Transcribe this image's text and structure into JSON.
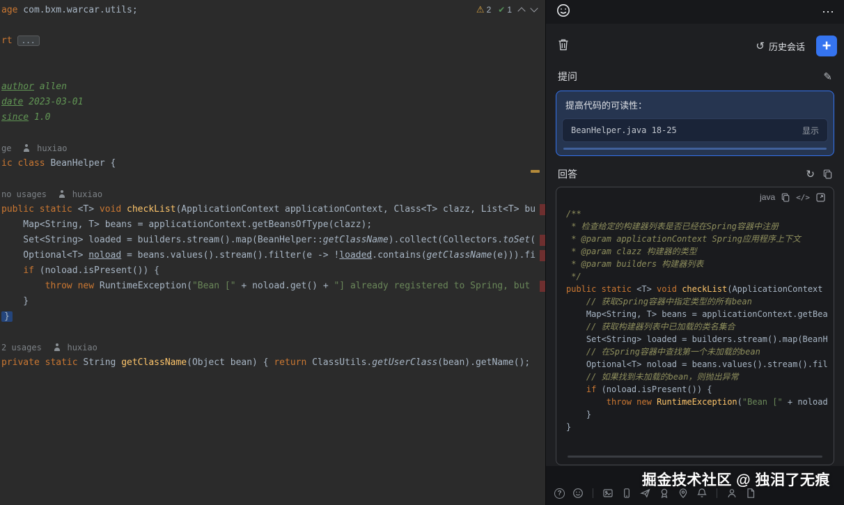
{
  "icons": {
    "warning": "⚠",
    "ok": "✔",
    "more": "⋯",
    "history": "↺",
    "plus": "+",
    "pencil": "✎",
    "refresh": "↻",
    "code": "</>",
    "help": "?"
  },
  "editor": {
    "inspections": {
      "warning_count": "2",
      "ok_count": "1"
    },
    "lines": [
      {
        "segs": [
          [
            "k",
            "age"
          ],
          [
            "t",
            " com.bxm.warcar.utils;"
          ]
        ]
      },
      {
        "segs": []
      },
      {
        "segs": [
          [
            "k",
            "rt"
          ],
          [
            "f",
            "..."
          ]
        ]
      },
      {
        "segs": []
      },
      {
        "segs": []
      },
      {
        "segs": [
          [
            "ct",
            "author"
          ],
          [
            "c",
            " allen"
          ]
        ]
      },
      {
        "segs": [
          [
            "ct",
            "date"
          ],
          [
            "c",
            " 2023-03-01"
          ]
        ]
      },
      {
        "segs": [
          [
            "ct",
            "since"
          ],
          [
            "c",
            " 1.0"
          ]
        ]
      },
      {
        "segs": []
      },
      {
        "segs": [
          [
            "g",
            "ge  "
          ],
          [
            "icon",
            "author-avatar-icon"
          ],
          [
            "g",
            " huxiao"
          ]
        ]
      },
      {
        "segs": [
          [
            "k",
            "ic class"
          ],
          [
            "t",
            " BeanHelper {"
          ]
        ]
      },
      {
        "segs": []
      },
      {
        "segs": [
          [
            "g",
            "no usages  "
          ],
          [
            "icon",
            "author-avatar-icon"
          ],
          [
            "g",
            " huxiao"
          ]
        ]
      },
      {
        "segs": [
          [
            "k",
            "public static"
          ],
          [
            "t",
            " <T> "
          ],
          [
            "k",
            "void"
          ],
          [
            "t",
            " "
          ],
          [
            "m",
            "checkList"
          ],
          [
            "t",
            "(ApplicationContext applicationContext, Class<T> clazz, List<T> bu"
          ]
        ],
        "edge": true
      },
      {
        "segs": [
          [
            "t",
            "    Map<String, T> beans = applicationContext.getBeansOfType(clazz);"
          ]
        ]
      },
      {
        "segs": [
          [
            "t",
            "    Set<String> loaded = builders.stream().map(BeanHelper::"
          ],
          [
            "i",
            "getClassName"
          ],
          [
            "t",
            ").collect(Collectors."
          ],
          [
            "i",
            "toSet"
          ],
          [
            "t",
            "("
          ]
        ],
        "edge": true
      },
      {
        "segs": [
          [
            "t",
            "    Optional<T> "
          ],
          [
            "u",
            "noload"
          ],
          [
            "t",
            " = beans.values().stream().filter(e -> !"
          ],
          [
            "u",
            "loaded"
          ],
          [
            "t",
            ".contains("
          ],
          [
            "i",
            "getClassName"
          ],
          [
            "t",
            "(e))).fi"
          ]
        ],
        "edge": true
      },
      {
        "segs": [
          [
            "t",
            "    "
          ],
          [
            "k",
            "if"
          ],
          [
            "t",
            " (noload.isPresent()) {"
          ]
        ]
      },
      {
        "segs": [
          [
            "t",
            "        "
          ],
          [
            "k",
            "throw new"
          ],
          [
            "t",
            " RuntimeException("
          ],
          [
            "s",
            "\"Bean [\""
          ],
          [
            "t",
            " + noload.get() + "
          ],
          [
            "s",
            "\"] already registered to Spring, but"
          ]
        ],
        "edge": true
      },
      {
        "segs": [
          [
            "t",
            "    }"
          ]
        ]
      },
      {
        "segs": [
          [
            "hlb",
            "}"
          ]
        ]
      },
      {
        "segs": []
      },
      {
        "segs": [
          [
            "g",
            "2 usages  "
          ],
          [
            "icon",
            "author-avatar-icon"
          ],
          [
            "g",
            " huxiao"
          ]
        ]
      },
      {
        "segs": [
          [
            "k",
            "private static"
          ],
          [
            "t",
            " String "
          ],
          [
            "m",
            "getClassName"
          ],
          [
            "t",
            "(Object bean) { "
          ],
          [
            "k",
            "return"
          ],
          [
            "t",
            " ClassUtils."
          ],
          [
            "i",
            "getUserClass"
          ],
          [
            "t",
            "(bean).getName();"
          ]
        ]
      }
    ]
  },
  "panel": {
    "toolbar": {
      "history_label": "历史会话"
    },
    "question": {
      "label": "提问",
      "text": "提高代码的可读性：",
      "file_ref": "BeanHelper.java 18-25",
      "show_label": "显示"
    },
    "answer": {
      "label": "回答",
      "lang_label": "java",
      "code_lines": [
        {
          "segs": [
            [
              "c",
              "/**"
            ]
          ]
        },
        {
          "segs": [
            [
              "c",
              " * 检查给定的构建器列表是否已经在Spring容器中注册"
            ]
          ]
        },
        {
          "segs": [
            [
              "c",
              " * @param applicationContext Spring应用程序上下文"
            ]
          ]
        },
        {
          "segs": [
            [
              "c",
              " * @param clazz 构建器的类型"
            ]
          ]
        },
        {
          "segs": [
            [
              "c",
              " * @param builders 构建器列表"
            ]
          ]
        },
        {
          "segs": [
            [
              "c",
              " */"
            ]
          ]
        },
        {
          "segs": [
            [
              "k",
              "public static"
            ],
            [
              "t",
              " <T> "
            ],
            [
              "k",
              "void"
            ],
            [
              "t",
              " "
            ],
            [
              "m",
              "checkList"
            ],
            [
              "t",
              "(ApplicationContext "
            ]
          ]
        },
        {
          "segs": [
            [
              "c",
              "    // 获取Spring容器中指定类型的所有bean"
            ]
          ]
        },
        {
          "segs": [
            [
              "t",
              "    Map<String, T> beans = applicationContext.getBea"
            ]
          ]
        },
        {
          "segs": [
            [
              "c",
              "    // 获取构建器列表中已加载的类名集合"
            ]
          ]
        },
        {
          "segs": [
            [
              "t",
              "    Set<String> loaded = builders.stream().map(BeanH"
            ]
          ]
        },
        {
          "segs": [
            [
              "c",
              "    // 在Spring容器中查找第一个未加载的bean"
            ]
          ]
        },
        {
          "segs": [
            [
              "t",
              "    Optional<T> noload = beans.values().stream().fil"
            ]
          ]
        },
        {
          "segs": [
            [
              "c",
              "    // 如果找到未加载的bean，则抛出异常"
            ]
          ]
        },
        {
          "segs": [
            [
              "t",
              "    "
            ],
            [
              "k",
              "if"
            ],
            [
              "t",
              " (noload.isPresent()) {"
            ]
          ]
        },
        {
          "segs": [
            [
              "t",
              "        "
            ],
            [
              "k",
              "throw new"
            ],
            [
              "t",
              " "
            ],
            [
              "m",
              "RuntimeException"
            ],
            [
              "t",
              "("
            ],
            [
              "s",
              "\"Bean [\""
            ],
            [
              "t",
              " + noload"
            ]
          ]
        },
        {
          "segs": [
            [
              "t",
              "    }"
            ]
          ]
        },
        {
          "segs": [
            [
              "t",
              "}"
            ]
          ]
        }
      ]
    },
    "watermark": "掘金技术社区 @ 独泪了无痕"
  }
}
